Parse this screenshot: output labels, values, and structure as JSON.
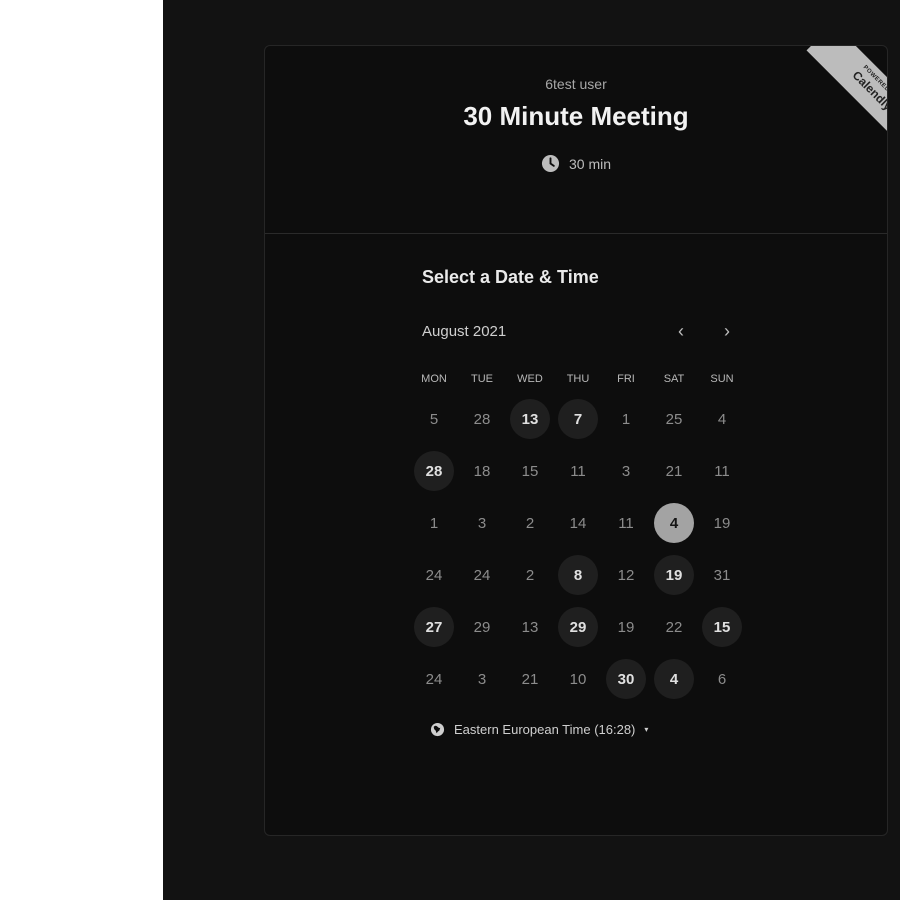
{
  "header": {
    "host_name": "6test user",
    "event_title": "30 Minute Meeting",
    "duration": "30 min",
    "ribbon_small": "POWERED BY",
    "ribbon_brand": "Calendly"
  },
  "calendar": {
    "section_title": "Select a Date & Time",
    "month_label": "August 2021",
    "prev_icon": "‹",
    "next_icon": "›",
    "weekdays": [
      "MON",
      "TUE",
      "WED",
      "THU",
      "FRI",
      "SAT",
      "SUN"
    ],
    "weeks": [
      [
        {
          "d": "5",
          "s": "none"
        },
        {
          "d": "28",
          "s": "none"
        },
        {
          "d": "13",
          "s": "available"
        },
        {
          "d": "7",
          "s": "available"
        },
        {
          "d": "1",
          "s": "none"
        },
        {
          "d": "25",
          "s": "none"
        },
        {
          "d": "4",
          "s": "none"
        }
      ],
      [
        {
          "d": "28",
          "s": "available"
        },
        {
          "d": "18",
          "s": "none"
        },
        {
          "d": "15",
          "s": "none"
        },
        {
          "d": "11",
          "s": "none"
        },
        {
          "d": "3",
          "s": "none"
        },
        {
          "d": "21",
          "s": "none"
        },
        {
          "d": "11",
          "s": "none"
        }
      ],
      [
        {
          "d": "1",
          "s": "none"
        },
        {
          "d": "3",
          "s": "none"
        },
        {
          "d": "2",
          "s": "none"
        },
        {
          "d": "14",
          "s": "none"
        },
        {
          "d": "11",
          "s": "none"
        },
        {
          "d": "4",
          "s": "selected"
        },
        {
          "d": "19",
          "s": "none"
        }
      ],
      [
        {
          "d": "24",
          "s": "none"
        },
        {
          "d": "24",
          "s": "none"
        },
        {
          "d": "2",
          "s": "none"
        },
        {
          "d": "8",
          "s": "available"
        },
        {
          "d": "12",
          "s": "none"
        },
        {
          "d": "19",
          "s": "available"
        },
        {
          "d": "31",
          "s": "none"
        }
      ],
      [
        {
          "d": "27",
          "s": "available"
        },
        {
          "d": "29",
          "s": "none"
        },
        {
          "d": "13",
          "s": "none"
        },
        {
          "d": "29",
          "s": "available"
        },
        {
          "d": "19",
          "s": "none"
        },
        {
          "d": "22",
          "s": "none"
        },
        {
          "d": "15",
          "s": "available"
        }
      ],
      [
        {
          "d": "24",
          "s": "none"
        },
        {
          "d": "3",
          "s": "none"
        },
        {
          "d": "21",
          "s": "none"
        },
        {
          "d": "10",
          "s": "none"
        },
        {
          "d": "30",
          "s": "available"
        },
        {
          "d": "4",
          "s": "available"
        },
        {
          "d": "6",
          "s": "none"
        }
      ]
    ]
  },
  "timezone": {
    "label": "Eastern European Time (16:28)",
    "icon": "globe-icon",
    "caret": "▾"
  },
  "colors": {
    "background": "#121212",
    "card": "#0d0d0d",
    "available_day": "#1f1f1f",
    "selected_day": "#a3a3a3"
  }
}
